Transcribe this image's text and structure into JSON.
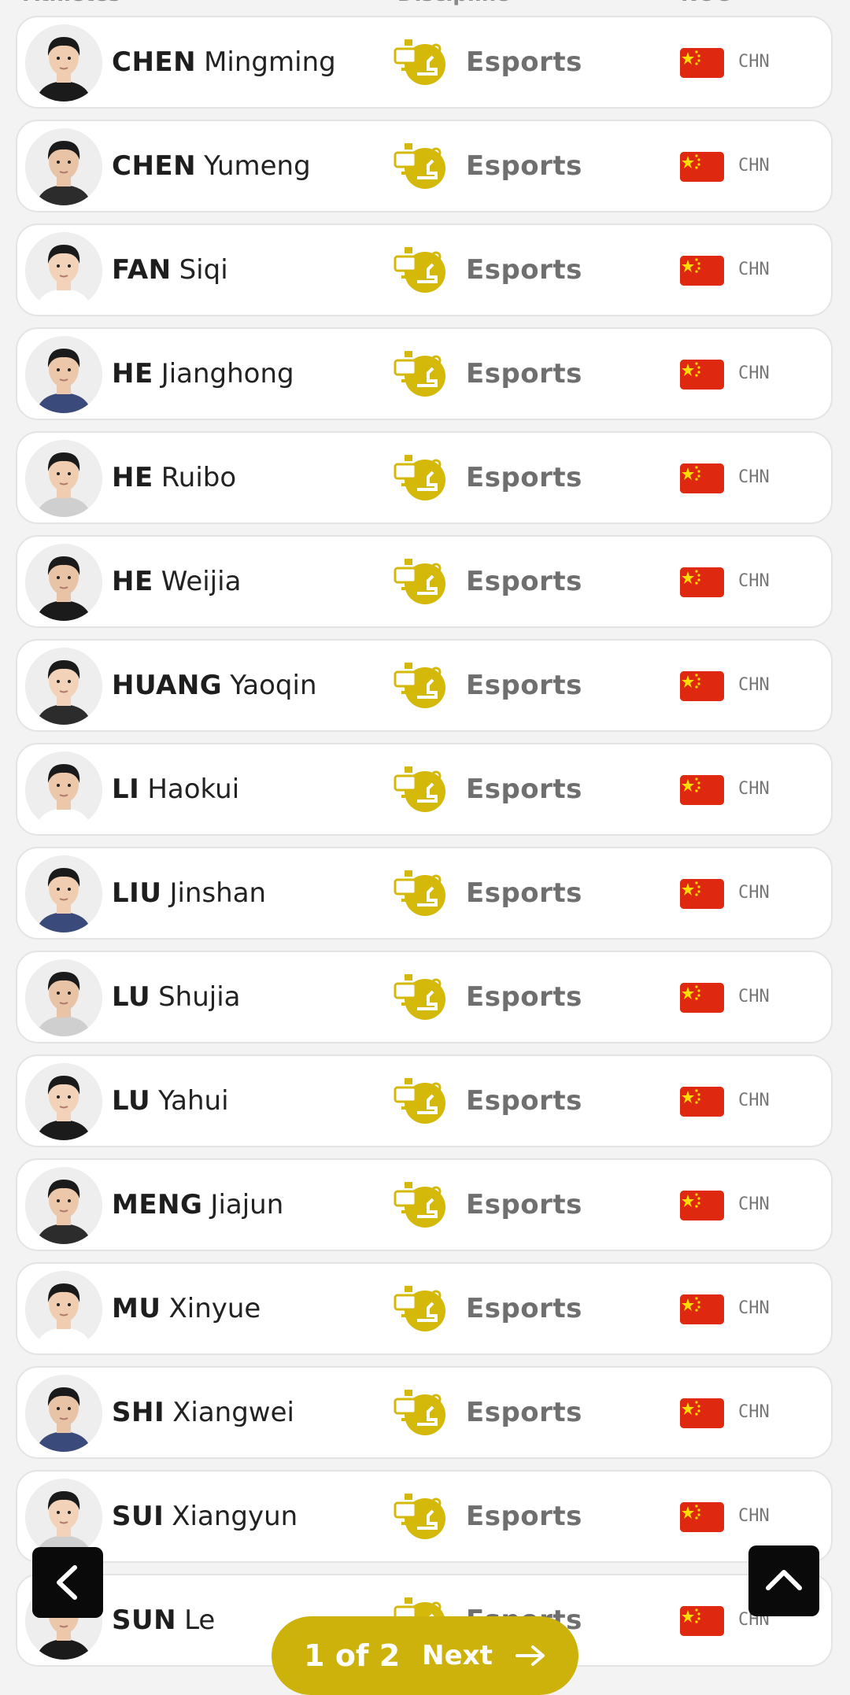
{
  "header": {
    "col_athletes": "Athletes",
    "col_discipline": "Discipline",
    "col_noc": "NOC"
  },
  "athletes": [
    {
      "family": "CHEN",
      "given": "Mingming",
      "discipline": "Esports",
      "noc": "CHN"
    },
    {
      "family": "CHEN",
      "given": "Yumeng",
      "discipline": "Esports",
      "noc": "CHN"
    },
    {
      "family": "FAN",
      "given": "Siqi",
      "discipline": "Esports",
      "noc": "CHN"
    },
    {
      "family": "HE",
      "given": "Jianghong",
      "discipline": "Esports",
      "noc": "CHN"
    },
    {
      "family": "HE",
      "given": "Ruibo",
      "discipline": "Esports",
      "noc": "CHN"
    },
    {
      "family": "HE",
      "given": "Weijia",
      "discipline": "Esports",
      "noc": "CHN"
    },
    {
      "family": "HUANG",
      "given": "Yaoqin",
      "discipline": "Esports",
      "noc": "CHN"
    },
    {
      "family": "LI",
      "given": "Haokui",
      "discipline": "Esports",
      "noc": "CHN"
    },
    {
      "family": "LIU",
      "given": "Jinshan",
      "discipline": "Esports",
      "noc": "CHN"
    },
    {
      "family": "LU",
      "given": "Shujia",
      "discipline": "Esports",
      "noc": "CHN"
    },
    {
      "family": "LU",
      "given": "Yahui",
      "discipline": "Esports",
      "noc": "CHN"
    },
    {
      "family": "MENG",
      "given": "Jiajun",
      "discipline": "Esports",
      "noc": "CHN"
    },
    {
      "family": "MU",
      "given": "Xinyue",
      "discipline": "Esports",
      "noc": "CHN"
    },
    {
      "family": "SHI",
      "given": "Xiangwei",
      "discipline": "Esports",
      "noc": "CHN"
    },
    {
      "family": "SUI",
      "given": "Xiangyun",
      "discipline": "Esports",
      "noc": "CHN"
    },
    {
      "family": "SUN",
      "given": "Le",
      "discipline": "Esports",
      "noc": "CHN"
    }
  ],
  "pagination": {
    "count_label": "1 of 2",
    "next_label": "Next"
  },
  "icons": {
    "back": "chevron-left-icon",
    "scroll_top": "chevron-up-icon",
    "next": "arrow-right-icon",
    "discipline": "esports-pictogram-icon",
    "flag": "china-flag-icon"
  },
  "colors": {
    "accent": "#cdb20c",
    "discipline_icon": "#d4b90a",
    "flag_red": "#de2910",
    "flag_star": "#ffde00",
    "button_dark": "#0a0a0a"
  }
}
